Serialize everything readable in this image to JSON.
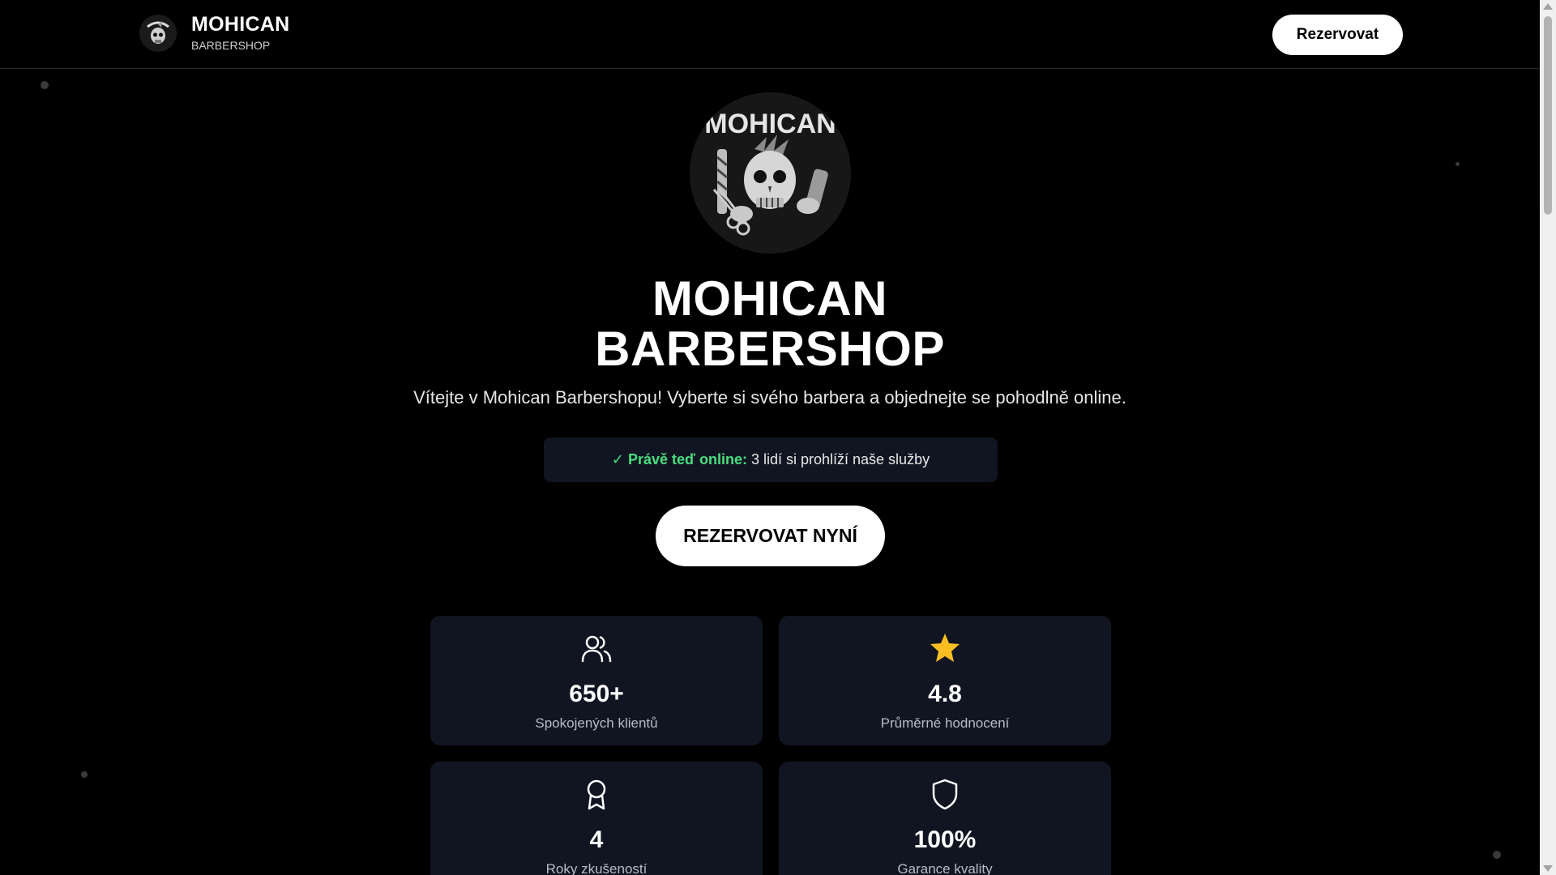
{
  "header": {
    "brand_name": "MOHICAN",
    "brand_sub": "BARBERSHOP",
    "logo_icon": "skull-mohawk-logo",
    "reserve_label": "Rezervovat"
  },
  "hero": {
    "logo_text": "MOHICAN",
    "title_line1": "MOHICAN",
    "title_line2": "BARBERSHOP",
    "subtitle": "Vítejte v Mohican Barbershopu! Vyberte si svého barbera a objednejte se pohodlně online.",
    "online_label": "✓ Právě teď online:",
    "online_text": "3 lidí si prohlíží naše služby",
    "cta_label": "REZERVOVAT NYNÍ"
  },
  "stats": [
    {
      "icon": "users-icon",
      "value": "650+",
      "label": "Spokojených klientů"
    },
    {
      "icon": "star-icon",
      "value": "4.8",
      "label": "Průměrné hodnocení"
    },
    {
      "icon": "award-icon",
      "value": "4",
      "label": "Roky zkušeností"
    },
    {
      "icon": "shield-icon",
      "value": "100%",
      "label": "Garance kvality"
    }
  ],
  "colors": {
    "background": "#000000",
    "card": "#111521",
    "online_green": "#4ade80",
    "star_yellow": "#fbbf24"
  }
}
